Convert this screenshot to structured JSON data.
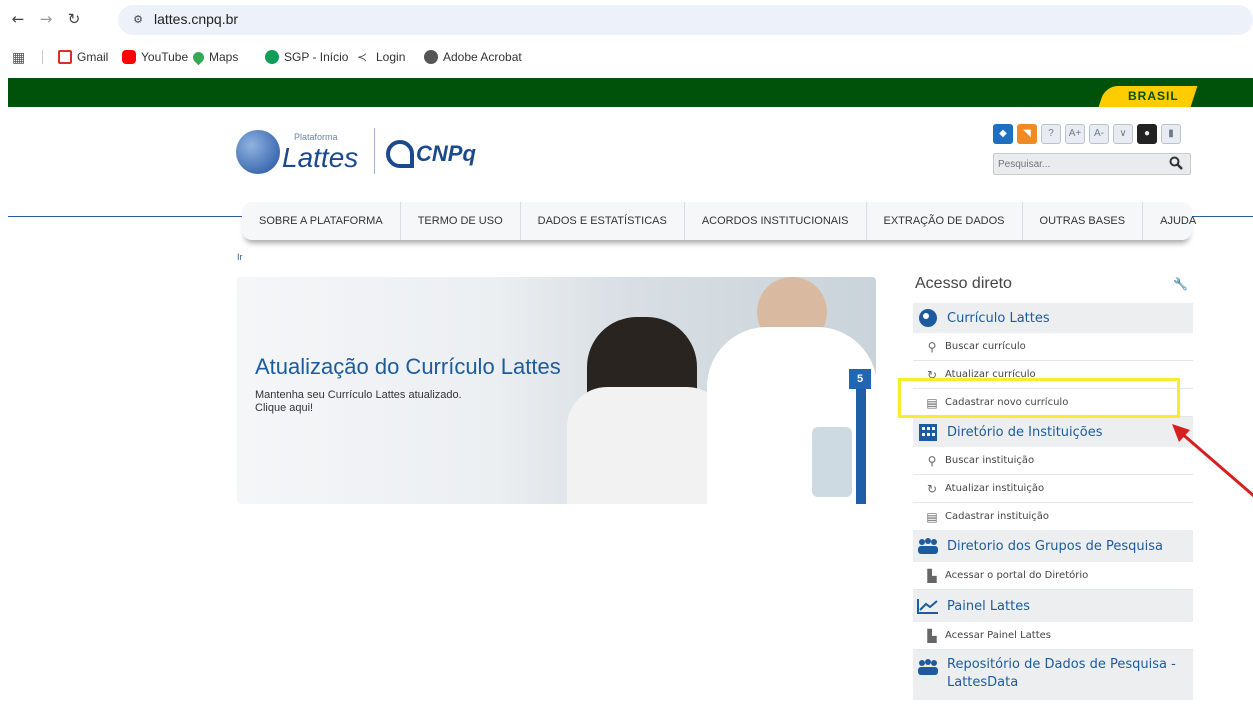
{
  "browser": {
    "url": "lattes.cnpq.br",
    "bookmarks": [
      {
        "label": "Gmail",
        "icon": "gmail-icon",
        "color": "#d93025"
      },
      {
        "label": "YouTube",
        "icon": "youtube-icon",
        "color": "#ff0000"
      },
      {
        "label": "Maps",
        "icon": "maps-icon",
        "color": "#34a853"
      },
      {
        "label": "SGP - Início",
        "icon": "sgp-icon",
        "color": "#0f9d58"
      },
      {
        "label": "Login",
        "icon": "login-icon",
        "color": "#555555"
      },
      {
        "label": "Adobe Acrobat",
        "icon": "globe-icon",
        "color": "#555555"
      }
    ]
  },
  "header": {
    "brasil_label": "BRASIL",
    "lattes_small": "Plataforma",
    "lattes_name": "Lattes",
    "cnpq_name": "CNPq",
    "tool_icons": [
      "delicious-icon",
      "rss-icon",
      "help-icon",
      "font-increase-icon",
      "font-decrease-icon",
      "collapse-icon",
      "contrast-icon",
      "lock-icon"
    ],
    "tool_labels": [
      "",
      "",
      "?",
      "A+",
      "A-",
      "",
      "",
      ""
    ],
    "search_placeholder": "Pesquisar..."
  },
  "nav": {
    "items": [
      "SOBRE A PLATAFORMA",
      "TERMO DE USO",
      "DADOS E ESTATÍSTICAS",
      "ACORDOS INSTITUCIONAIS",
      "EXTRAÇÃO DE DADOS",
      "OUTRAS BASES",
      "AJUDA"
    ]
  },
  "breadcrumb": "Ir",
  "banner": {
    "title": "Atualização do Currículo Lattes",
    "subtitle1": "Mantenha seu Currículo Lattes atualizado.",
    "subtitle2": "Clique aqui!",
    "slide_number": "5"
  },
  "sidebar": {
    "title": "Acesso direto",
    "sections": [
      {
        "title": "Currículo Lattes",
        "links": [
          "Buscar currículo",
          "Atualizar currículo",
          "Cadastrar novo currículo"
        ]
      },
      {
        "title": "Diretório de Instituições",
        "links": [
          "Buscar instituição",
          "Atualizar instituição",
          "Cadastrar instituição"
        ]
      },
      {
        "title": "Diretorio dos Grupos de Pesquisa",
        "links": [
          "Acessar o portal do Diretório"
        ]
      },
      {
        "title": "Painel Lattes",
        "links": [
          "Acessar Painel Lattes"
        ]
      },
      {
        "title": "Repositório de Dados de Pesquisa - LattesData",
        "links": []
      }
    ]
  },
  "colors": {
    "gov_green": "#00510a",
    "brasil_yellow": "#ffcc00",
    "link_blue": "#1d5b9d",
    "highlight": "#f3ee2e",
    "arrow": "#d61f1f"
  }
}
